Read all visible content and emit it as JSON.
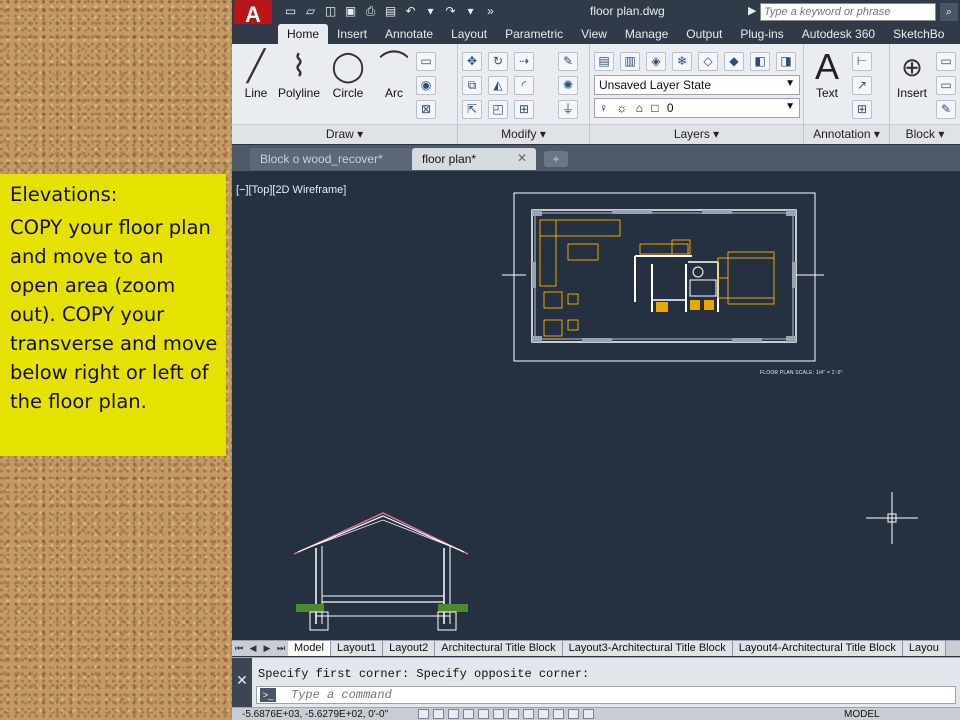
{
  "callout": {
    "heading": "Elevations:",
    "body": "COPY your floor plan and move to an open area (zoom out).  COPY your transverse and move below right or left of the floor plan."
  },
  "app": {
    "logo_letter": "A",
    "window_title": "floor plan.dwg",
    "search_placeholder": "Type a keyword or phrase",
    "ribbon_tabs": [
      "Home",
      "Insert",
      "Annotate",
      "Layout",
      "Parametric",
      "View",
      "Manage",
      "Output",
      "Plug-ins",
      "Autodesk 360",
      "SketchBo"
    ],
    "active_tab": "Home",
    "draw_tools": [
      "Line",
      "Polyline",
      "Circle",
      "Arc"
    ],
    "panels": {
      "draw": "Draw ▾",
      "modify": "Modify ▾",
      "layers": "Layers ▾",
      "annotation": "Annotation ▾",
      "block": "Block ▾"
    },
    "layer_state": "Unsaved Layer State",
    "current_layer": "0",
    "annotation_tool": "Text",
    "block_tool": "Insert",
    "doc_tabs": [
      "Block o wood_recover*",
      "floor plan*"
    ],
    "doc_tab_close": "✕",
    "viewport_label": "[−][Top][2D Wireframe]",
    "scale_note": "FLOOR PLAN SCALE: 1/4\" = 1'-0\"",
    "layout_tabs": [
      "Model",
      "Layout1",
      "Layout2",
      "Architectural Title Block",
      "Layout3-Architectural Title Block",
      "Layout4-Architectural Title Block",
      "Layou"
    ],
    "command_history": "Specify first corner: Specify opposite corner:",
    "command_placeholder": "Type a command",
    "coordinates": "-5.6876E+03, -5.6279E+02, 0'-0\"",
    "model_label": "MODEL",
    "colors": {
      "canvas": "#253040",
      "furniture": "#e8a800",
      "walls": "#ffffff",
      "roof": "#e26ea0",
      "ground": "#4e8a2a",
      "callout": "#e5e100"
    }
  }
}
